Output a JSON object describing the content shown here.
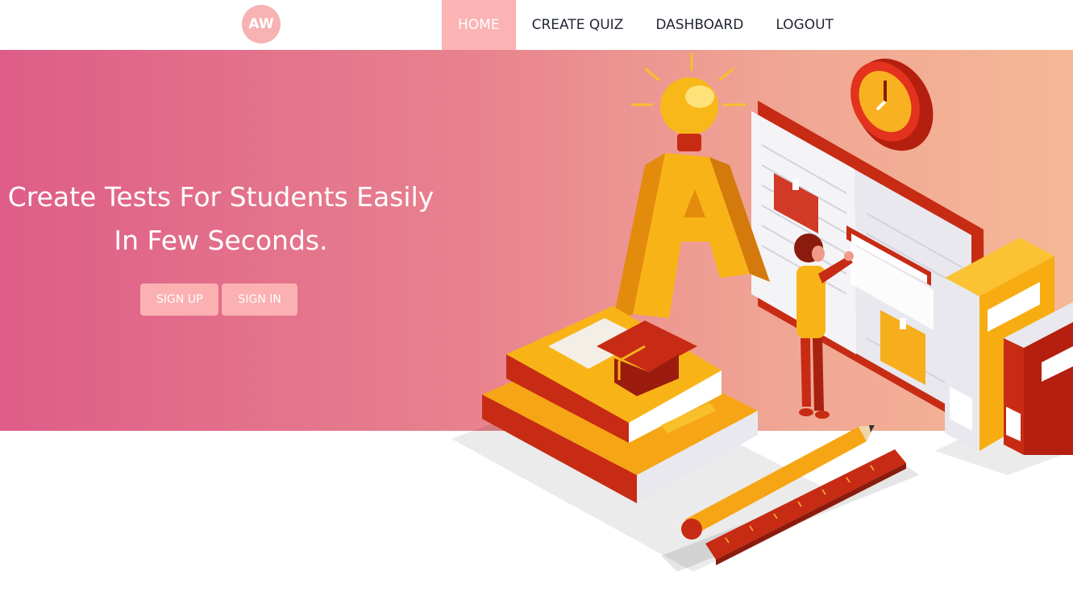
{
  "navbar": {
    "logo_text": "AW",
    "links": [
      {
        "label": "HOME",
        "active": true
      },
      {
        "label": "CREATE QUIZ",
        "active": false
      },
      {
        "label": "DASHBOARD",
        "active": false
      },
      {
        "label": "LOGOUT",
        "active": false
      }
    ]
  },
  "hero": {
    "headline_line1": "Create Tests For Students Easily",
    "headline_line2": "In Few Seconds.",
    "signup_label": "SIGN UP",
    "signin_label": "SIGN IN"
  },
  "colors": {
    "gradient_start": "#de5d88",
    "gradient_end": "#f5b896",
    "accent_pink": "#fbb3b4",
    "nav_text": "#1f2530"
  },
  "illustration": {
    "icons": [
      "lightbulb-icon",
      "clock-icon",
      "graduation-cap-icon",
      "pencil-icon",
      "ruler-icon",
      "book-icon",
      "student-icon"
    ]
  }
}
